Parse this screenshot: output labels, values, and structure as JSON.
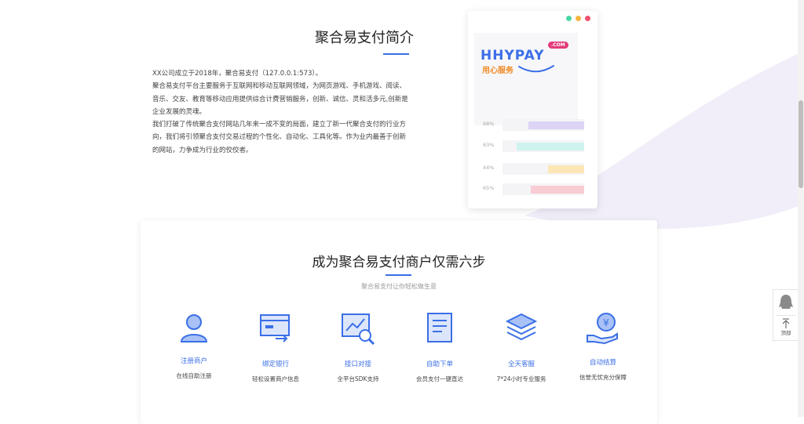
{
  "intro": {
    "title": "聚合易支付简介",
    "paragraphs": [
      "XX公司成立于2018年，聚合易支付（127.0.0.1:573）。",
      "聚合易支付平台主要服务于互联网和移动互联网领域，为网页游戏、手机游戏、阅读、音乐、交友、教育等移动应用提供综合计费营销服务，创新、诚信、灵和活多元,创新是企业发展的灵魂。",
      "我们打破了传统聚合支付网站几年来一成不变的局面，建立了新一代聚合支付的行业方向，我们将引领聚合支付交易过程的个性化、自动化、工具化等。作为业内最善于创新的网站，力争成为行业的佼佼者。"
    ]
  },
  "mockup": {
    "dots_colors": [
      "#4cd6a4",
      "#f5b540",
      "#f0506e"
    ],
    "brand": "HHYPAY",
    "brand_badge": ".COM",
    "slogan": "用心服务",
    "stats": [
      {
        "label": "68%",
        "value": 0.68,
        "color": "#dcd3f5"
      },
      {
        "label": "83%",
        "value": 0.83,
        "color": "#cff3ee"
      },
      {
        "label": "44%",
        "value": 0.44,
        "color": "#fce6b5"
      },
      {
        "label": "65%",
        "value": 0.65,
        "color": "#f7ccd3"
      }
    ]
  },
  "steps": {
    "title": "成为聚合易支付商户仅需六步",
    "subtitle": "聚合易支付让你轻松做生意",
    "accent": "#3a6fe6",
    "items": [
      {
        "icon": "user-icon",
        "name": "注册商户",
        "desc": "在线自助注册"
      },
      {
        "icon": "bank-card-icon",
        "name": "绑定银行",
        "desc": "轻松设置商户信息"
      },
      {
        "icon": "chart-search-icon",
        "name": "接口对接",
        "desc": "全平台SDK支持"
      },
      {
        "icon": "document-icon",
        "name": "自助下单",
        "desc": "会员支付一键直达"
      },
      {
        "icon": "layers-icon",
        "name": "全天客服",
        "desc": "7*24小时专业服务"
      },
      {
        "icon": "coin-hand-icon",
        "name": "自动结算",
        "desc": "信誉无忧充分保障"
      }
    ]
  },
  "float_tools": {
    "top_label": "顶部"
  }
}
